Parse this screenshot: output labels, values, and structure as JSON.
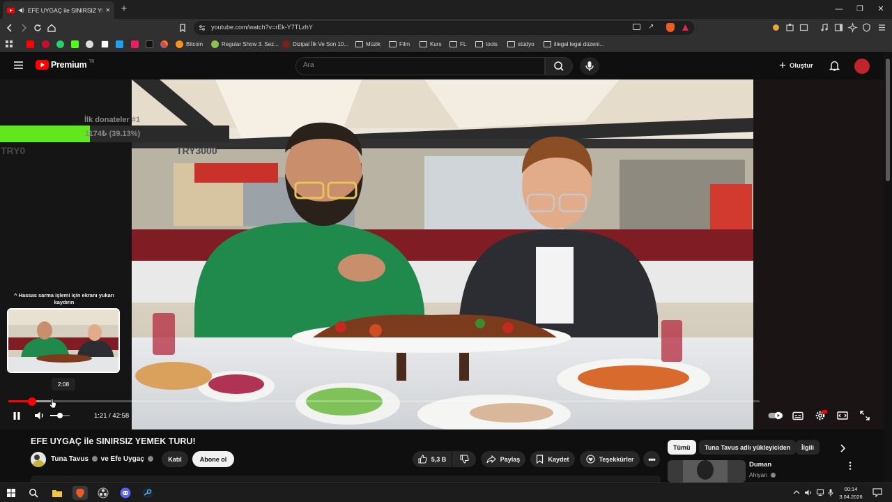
{
  "browser": {
    "tab_title": "EFE UYGAÇ ile SINIRSIZ YEME",
    "new_tab": "+",
    "url": "youtube.com/watch?v=rEk-Y7TLzhY",
    "bookmarks": [
      "Bitcoin",
      "Regular Show 3. Sez...",
      "Dizipal İlk Ve Son 10...",
      "Müzik",
      "Film",
      "Kurs",
      "FL",
      "tools",
      "stüdyo",
      "illegal legal düzeni..."
    ]
  },
  "youtube": {
    "logo_text": "Premium",
    "logo_region": "TR",
    "search_placeholder": "Ara",
    "create_label": "Oluştur"
  },
  "overlay": {
    "donate_title": "İlk donateler #1",
    "donate_text": "1174₺ (39.13%)",
    "donate_progress": 0.3913,
    "min_label": "TRY0",
    "max_label": "TRY3000"
  },
  "player": {
    "scrub_hint": "^ Hassas sarma işlemi için ekranı yukarı kaydırın",
    "preview_time": "2:08",
    "time_display": "1:21 / 42:58",
    "played_fraction": 0.0314,
    "hover_fraction": 0.0566,
    "volume_fraction": 0.5
  },
  "video": {
    "title": "EFE UYGAÇ ile SINIRSIZ YEMEK TURU!",
    "channel": "Tuna Tavus",
    "collab": "ve Efe Uygaç",
    "join_label": "Katıl",
    "subscribe_label": "Abone ol",
    "likes": "5,3 B",
    "share_label": "Paylaş",
    "save_label": "Kaydet",
    "thanks_label": "Teşekkürler"
  },
  "recommendations": {
    "chips": [
      "Tümü",
      "Tuna Tavus adlı yükleyiciden",
      "İlgili"
    ],
    "first": {
      "title": "Duman",
      "channel": "Ahiyan"
    }
  },
  "taskbar": {
    "time": "00:14",
    "date": "3.04.2026"
  }
}
